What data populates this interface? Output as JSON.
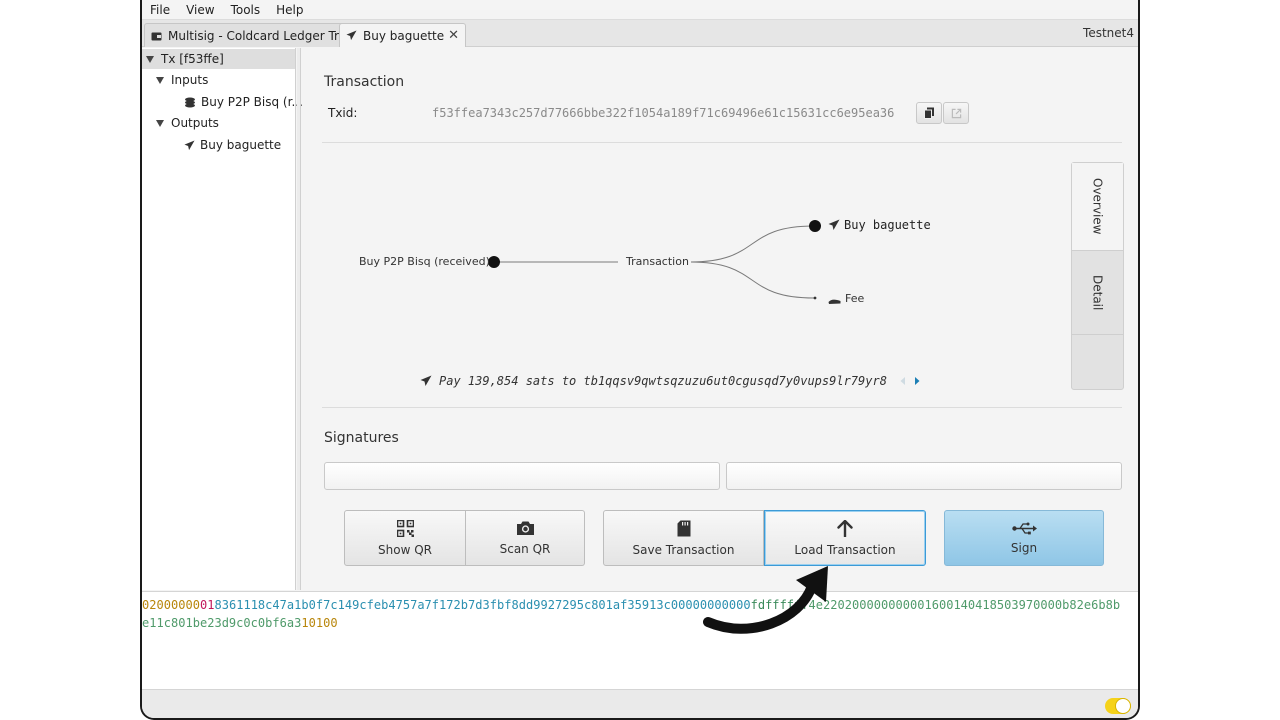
{
  "menu": [
    "File",
    "View",
    "Tools",
    "Help"
  ],
  "tabs": [
    {
      "label": "Multisig - Coldcard Ledger Trezor",
      "active": false
    },
    {
      "label": "Buy baguette",
      "active": true,
      "close": "✕"
    }
  ],
  "network": "Testnet4",
  "tree": {
    "root": "Tx [f53ffe]",
    "inputs_label": "Inputs",
    "input_item": "Buy P2P Bisq (r...",
    "outputs_label": "Outputs",
    "output_item": "Buy baguette"
  },
  "transaction": {
    "title": "Transaction",
    "txid_label": "Txid:",
    "txid": "f53ffea7343c257d77666bbe322f1054a189f71c69496e61c15631cc6e95ea36"
  },
  "diagram": {
    "input_label": "Buy P2P Bisq (received)",
    "center_label": "Transaction",
    "output_label": "Buy baguette",
    "fee_label": "Fee",
    "payment_text": "Pay 139,854 sats to tb1qqsv9qwtsqzuzu6ut0cgusqd7y0vups9lr79yr8"
  },
  "side_tabs": [
    "Overview",
    "Detail"
  ],
  "signatures": {
    "title": "Signatures"
  },
  "buttons": {
    "show_qr": "Show QR",
    "scan_qr": "Scan QR",
    "save_tx": "Save Transaction",
    "load_tx": "Load Transaction",
    "sign": "Sign"
  },
  "hex": {
    "line1": [
      {
        "text": "02000000",
        "color": "#b8860b"
      },
      {
        "text": "01",
        "color": "#c2185b"
      },
      {
        "text": "8361118c47a1b0f7c149cfeb4757a7f172b7d3fbf8dd9927295c801af35913c00000000000",
        "color": "#2a8fb0"
      },
      {
        "text": "fdff",
        "color": "#3a8a5a"
      },
      {
        "text": "ffff",
        "color": "#3a8a5a"
      },
      {
        "text": "4e220200000000001600140418503970000b82e6b8b",
        "color": "#4f9a6a"
      }
    ],
    "line2": [
      {
        "text": "e11c801be23d9c0c0bf6a3",
        "color": "#4f9a6a"
      },
      {
        "text": "10100",
        "color": "#b8860b"
      }
    ]
  },
  "colors": {
    "accent": "#3c9ad6",
    "sign_button": "#a6d3ee",
    "nav_arrow_active": "#1c7fb5",
    "toggle": "#f5d21a"
  }
}
